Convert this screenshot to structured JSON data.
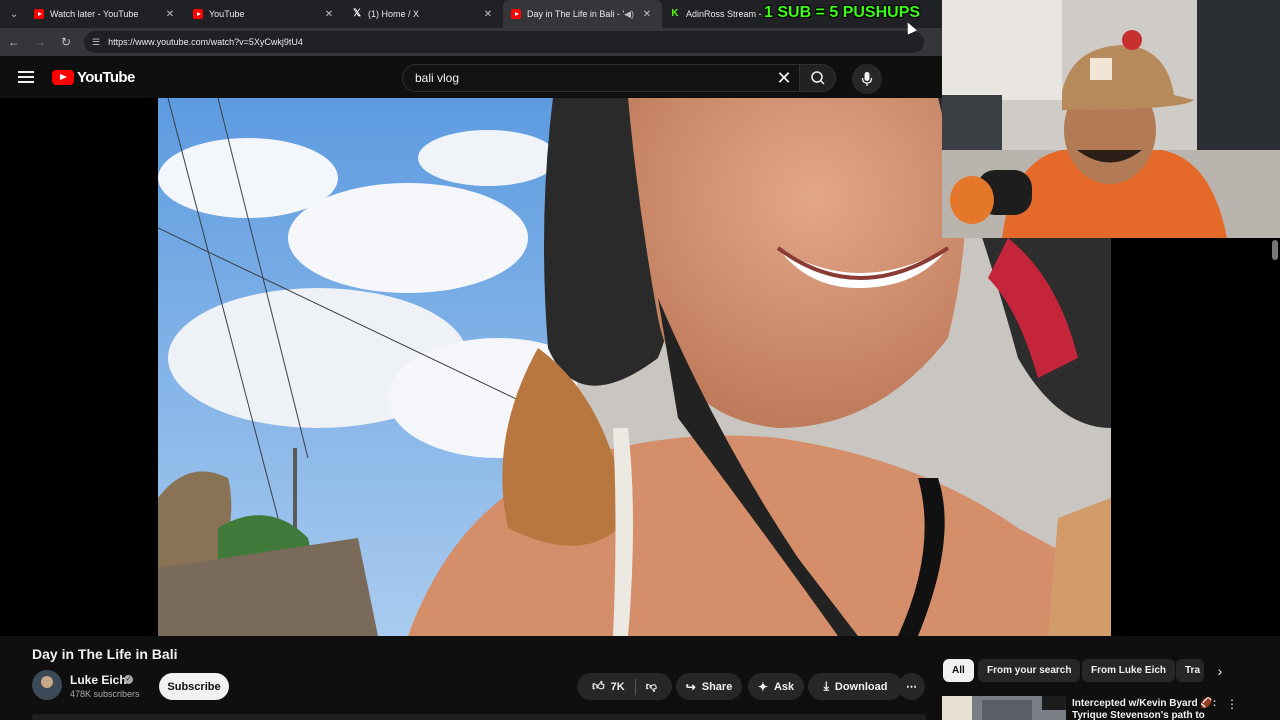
{
  "browser": {
    "tabs": [
      {
        "label": "Watch later - YouTube",
        "favicon": "youtube-icon"
      },
      {
        "label": "YouTube",
        "favicon": "youtube-icon"
      },
      {
        "label": "(1) Home / X",
        "favicon": "x-icon"
      },
      {
        "label": "Day in The Life in Bali - You",
        "favicon": "youtube-icon",
        "active": true,
        "audio": true
      },
      {
        "label": "AdinRoss Stream - Watch Live",
        "favicon": "kick-icon"
      }
    ],
    "url": "https://www.youtube.com/watch?v=5XyCwkj9tU4"
  },
  "header": {
    "logo": "YouTube",
    "search_value": "bali vlog"
  },
  "stream_overlay": {
    "banner": "1 SUB = 5 PUSHUPS"
  },
  "video": {
    "title": "Day in The Life in Bali",
    "channel": "Luke Eich",
    "subscribers": "478K subscribers",
    "subscribe_label": "Subscribe",
    "likes": "7K",
    "share_label": "Share",
    "ask_label": "Ask",
    "download_label": "Download"
  },
  "chips": [
    "All",
    "From your search",
    "From Luke Eich",
    "Tra"
  ],
  "recommended": {
    "title": "Intercepted w/Kevin Byard 🏈: Tyrique Stevenson's path to N..."
  },
  "colors": {
    "accent": "#ff0000",
    "banner": "#39ff14",
    "background": "#0f0f0f"
  }
}
